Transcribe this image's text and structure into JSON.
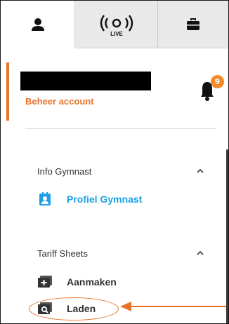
{
  "tabs": [
    {
      "name": "profile",
      "icon": "user-icon",
      "active": true
    },
    {
      "name": "live",
      "icon": "live-broadcast-icon",
      "label": "LIVE",
      "active": false
    },
    {
      "name": "briefcase",
      "icon": "briefcase-icon",
      "active": false
    }
  ],
  "account": {
    "manage_label": "Beheer account",
    "notifications_count": "9"
  },
  "sections": [
    {
      "title": "Info Gymnast",
      "items": [
        {
          "label": "Profiel Gymnast",
          "icon": "profile-card-icon",
          "active": true
        }
      ]
    },
    {
      "title": "Tariff Sheets",
      "items": [
        {
          "label": "Aanmaken",
          "icon": "add-sheet-icon",
          "active": false
        },
        {
          "label": "Laden",
          "icon": "load-sheet-icon",
          "active": false
        }
      ]
    }
  ],
  "colors": {
    "accent": "#e8742a",
    "active_blue": "#1ea0e6",
    "badge": "#f28a27",
    "tab_inactive": "#e9e9e9"
  }
}
